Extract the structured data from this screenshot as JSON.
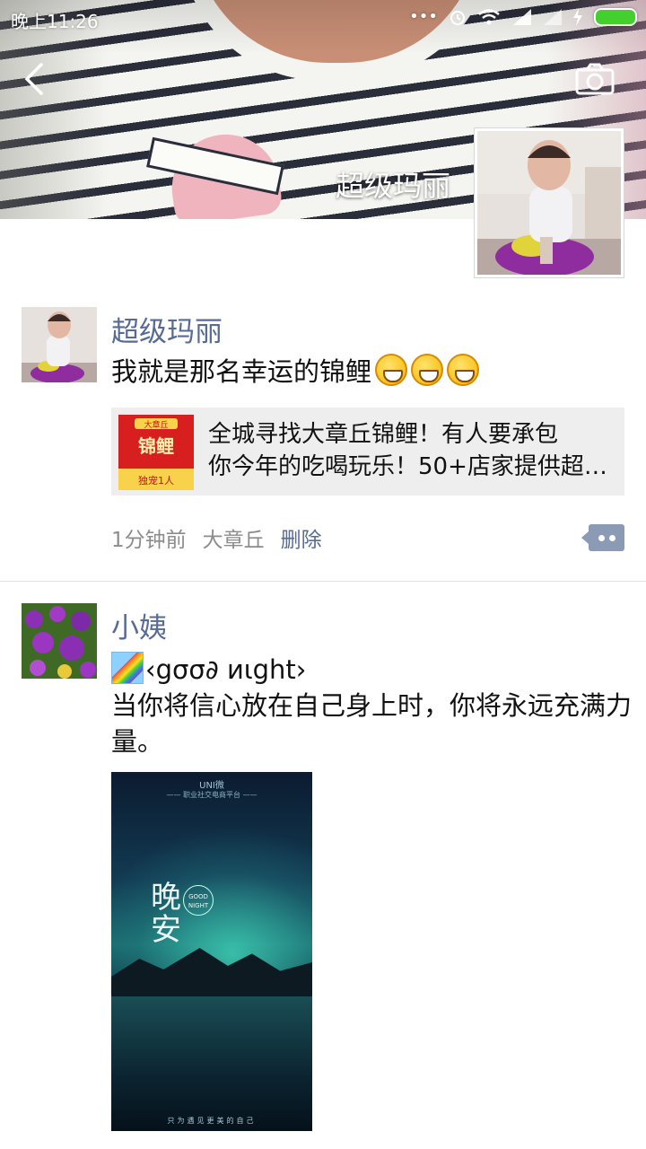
{
  "status_bar": {
    "time": "晚上11:26",
    "icons": [
      "more-icon",
      "alarm-icon",
      "wifi-icon",
      "signal-icon",
      "signal-icon",
      "charging-icon",
      "battery-icon"
    ],
    "battery_color": "#43d02f"
  },
  "header": {
    "back_icon": "chevron-left-icon",
    "camera_icon": "camera-icon",
    "cover_name": "超级玛丽"
  },
  "colors": {
    "name_link": "#576b95",
    "meta_text": "#8c8c8c",
    "link_card_bg": "#eeeeee"
  },
  "posts": [
    {
      "author": "超级玛丽",
      "text": "我就是那名幸运的锦鲤",
      "emojis": [
        "grin-emoji",
        "grin-emoji",
        "grin-emoji"
      ],
      "link_card": {
        "line1": "全城寻找大章丘锦鲤！有人要承包",
        "line2": "你今年的吃喝玩乐！50+店家提供超…",
        "thumb_badge": "大章丘",
        "thumb_title": "锦鲤",
        "thumb_footer": "独宠1人"
      },
      "time": "1分钟前",
      "location": "大章丘",
      "delete_label": "删除",
      "comment_icon": "comment-icon"
    },
    {
      "author": "小姨",
      "line1": "‹gσσ∂ иιght›",
      "line1_emoji": "rainbow-emoji",
      "text": "当你将信心放在自己身上时，你将永远充满力量。",
      "image": {
        "brand": "UNI微",
        "tagline": "—— 职业社交电商平台 ——",
        "big_text": "晚\n安",
        "circle_text": "GOOD NIGHT",
        "footer": "只为遇见更美的自己"
      }
    }
  ]
}
